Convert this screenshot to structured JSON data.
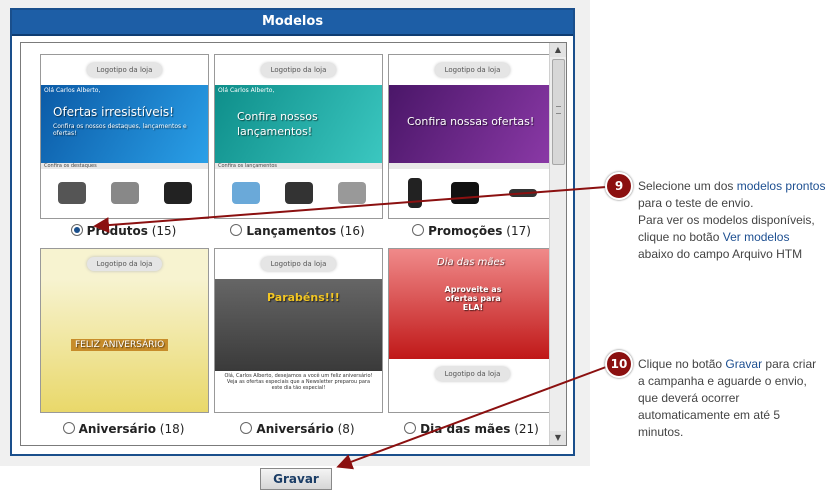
{
  "dialog": {
    "title": "Modelos",
    "logo_text": "Logotipo da loja"
  },
  "templates": [
    {
      "name": "Produtos",
      "count": "(15)",
      "checked": true,
      "greeting": "Olá Carlos Alberto,",
      "headline": "Ofertas irresistíveis!",
      "subline": "Confira os nossos destaques, lançamentos e ofertas!",
      "strip": "Confira os destaques",
      "bg": "#1f78c7"
    },
    {
      "name": "Lançamentos",
      "count": "(16)",
      "checked": false,
      "greeting": "Olá Carlos Alberto,",
      "headline": "Confira nossos lançamentos!",
      "subline": "",
      "strip": "Confira os lançamentos",
      "bg": "#23a5a0"
    },
    {
      "name": "Promoções",
      "count": "(17)",
      "checked": false,
      "greeting": "",
      "headline": "Confira nossas ofertas!",
      "subline": "",
      "strip": "",
      "bg": "#6d2a88"
    },
    {
      "name": "Aniversário",
      "count": "(18)",
      "checked": false,
      "greeting": "",
      "headline": "FELIZ ANIVERSÁRIO",
      "subline": "",
      "strip": "",
      "bg": "#f1e27a"
    },
    {
      "name": "Aniversário",
      "count": "(8)",
      "checked": false,
      "greeting": "",
      "headline": "Parabéns!!!",
      "subline": "Olá, Carlos Alberto, desejamos a você um feliz aniversário! Veja as ofertas especiais que a Newsletter preparou para este dia tão especial!",
      "strip": "",
      "bg": "#5a5a5a"
    },
    {
      "name": "Dia das mães",
      "count": "(21)",
      "checked": false,
      "greeting": "",
      "headline": "Dia das mães",
      "subline": "Aproveite as ofertas para ELA!",
      "strip": "",
      "bg": "#d22a2a"
    }
  ],
  "buttons": {
    "save": "Gravar"
  },
  "callouts": [
    {
      "number": "9",
      "lines": [
        "Selecione um dos ",
        "modelos prontos",
        " para o teste de envio.",
        "Para ver os modelos disponíveis, clique no botão ",
        "Ver modelos",
        " abaixo do campo  Arquivo HTM"
      ]
    },
    {
      "number": "10",
      "lines": [
        "Clique no botão ",
        "Gravar",
        " para criar a campanha e aguarde o envio, que deverá ocorrer automaticamente em até 5 minutos."
      ]
    }
  ],
  "colors": {
    "header": "#1d5ea6",
    "callout": "#8b1010",
    "arrow": "#8b1010",
    "link": "#1d4f91"
  }
}
